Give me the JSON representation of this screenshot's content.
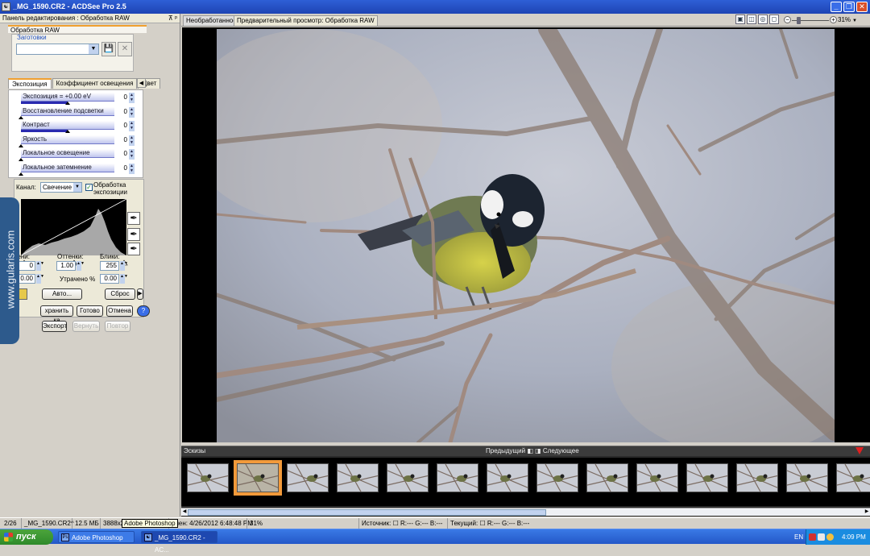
{
  "window": {
    "title": "_MG_1590.CR2 - ACDSee Pro 2.5",
    "app_icon": "acdsee-icon"
  },
  "panel": {
    "header": "Панель редактирования : Обработка RAW",
    "pin": "⊼ ᵖ",
    "section": "Обработка RAW"
  },
  "presets": {
    "label": "Заготовки",
    "value": ""
  },
  "tabs": [
    "Экспозиция",
    "Коэффициент освещения",
    "Цвет"
  ],
  "sliders": [
    {
      "label": "Экспозиция = +0.00 eV",
      "value": "0",
      "fill": 0.5
    },
    {
      "label": "Восстановление подсветки",
      "value": "0",
      "fill": 0
    },
    {
      "label": "Контраст",
      "value": "0",
      "fill": 0.5
    },
    {
      "label": "Яркость",
      "value": "0",
      "fill": 0
    },
    {
      "label": "Локальное освещение",
      "value": "0",
      "fill": 0
    },
    {
      "label": "Локальное затемнение",
      "value": "0",
      "fill": 0
    }
  ],
  "levels": {
    "channel_label": "Канал:",
    "channel_value": "Свечение",
    "checkbox_label": "Обработка экспозиции",
    "checkbox_checked": "✓",
    "shadows_label": "Тени:",
    "midtones_label": "Оттенки:",
    "highlights_label": "Блики:",
    "shadows": "0",
    "midtones": "1.00",
    "highlights": "255",
    "shadows_clip": "0.00",
    "lost_label": "Утрачено %",
    "highlights_clip": "0.00",
    "auto": "Авто...",
    "reset": "Сброс"
  },
  "actions": {
    "save": "хранить ка",
    "done": "Готово",
    "cancel": "Отмена",
    "help": "?",
    "export": "Экспорт",
    "revert": "Вернуть",
    "redo": "Повтор"
  },
  "watermark": "www.gularis.com",
  "main_tabs": [
    "Необработанное",
    "Предварительный просмотр: Обработка RAW"
  ],
  "zoom": "31%",
  "thumbstrip": {
    "title": "Эскизы",
    "prev": "Предыдущий",
    "next": "Следующее",
    "count": 14,
    "selected": 1
  },
  "status": {
    "index": "2/26",
    "filename": "_MG_1590.CR2^",
    "size": "12.5 МБ",
    "dims": "3888x2",
    "tooltip": "Adobe Photoshop",
    "date": "енен: 4/26/2012 6:48:48 PM",
    "zoom": "31%",
    "source": "Источник: ☐ R:--- G:--- B:---",
    "current": "Текущий: ☐ R:--- G:--- B:---"
  },
  "taskbar": {
    "start": "пуск",
    "tasks": [
      "Adobe Photoshop",
      "_MG_1590.CR2 - AC..."
    ],
    "lang": "EN",
    "time": "4:09 PM"
  }
}
